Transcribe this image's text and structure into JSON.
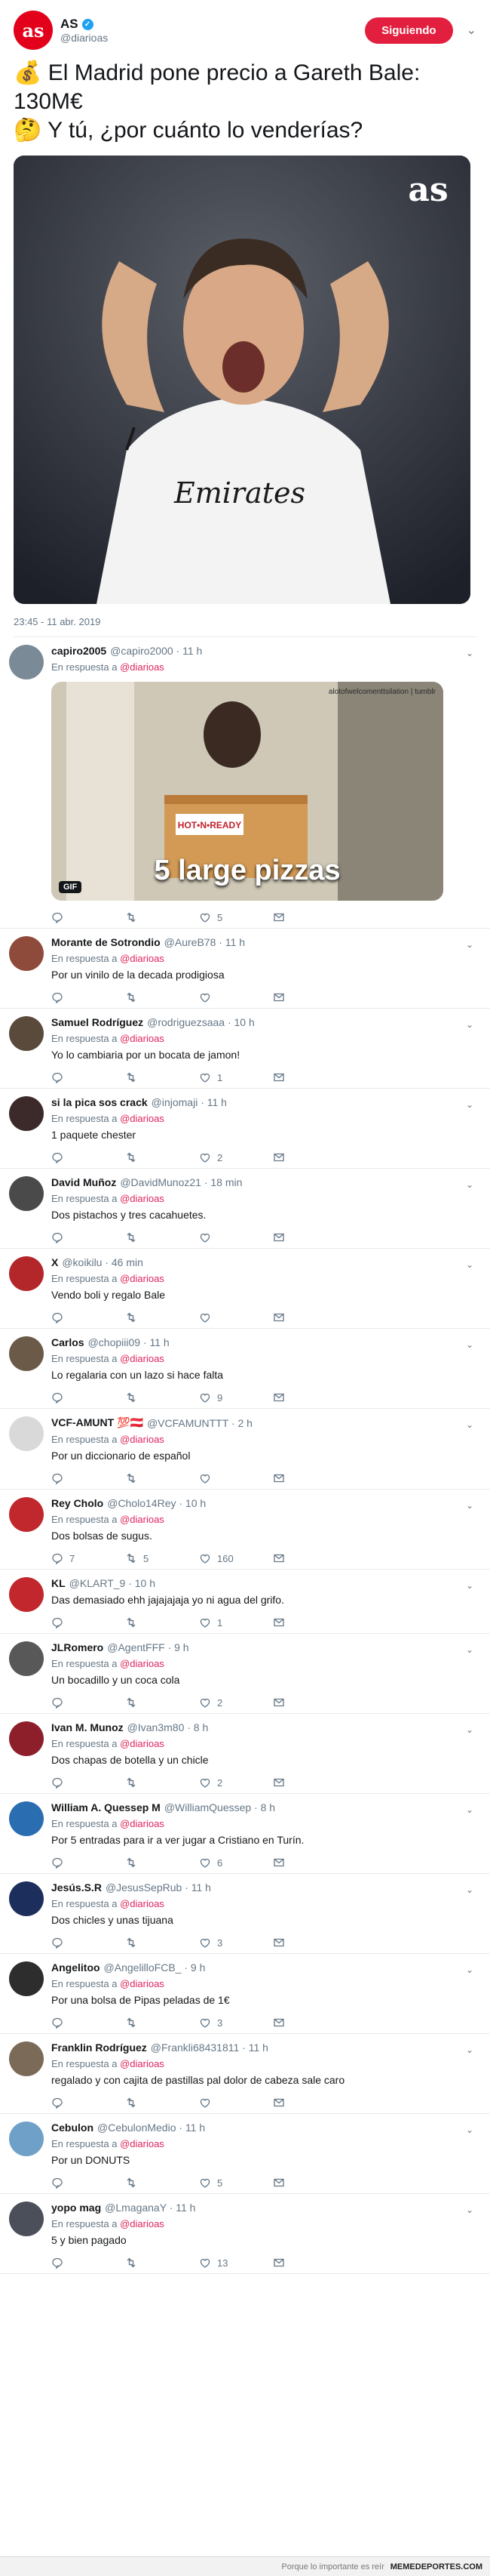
{
  "header": {
    "avatar_text": "as",
    "name": "AS",
    "handle": "@diarioas",
    "follow_label": "Siguiendo"
  },
  "tweet": {
    "line1": "💰 El Madrid pone precio a Gareth Bale: 130M€",
    "line2": "🤔 Y tú, ¿por cuánto lo venderías?",
    "image_logo": "as",
    "timestamp": "23:45 - 11 abr. 2019"
  },
  "replies": [
    {
      "name": "capiro2005",
      "handle": "@capiro2000 · 11 h",
      "resp": "En respuesta a",
      "mention": "@diarioas",
      "text": "",
      "gif": true,
      "gif_caption": "5 large pizzas",
      "gif_badge": "GIF",
      "gif_watermark": "alotofwelcomenttsilation | tumblr",
      "comments": "",
      "retweets": "",
      "likes": "5",
      "avatar_color": "#7a8a96"
    },
    {
      "name": "Morante de Sotrondio",
      "handle": "@AureB78 · 11 h",
      "resp": "En respuesta a",
      "mention": "@diarioas",
      "text": "Por un vinilo de la decada prodigiosa",
      "comments": "",
      "retweets": "",
      "likes": "",
      "avatar_color": "#8e4a3a"
    },
    {
      "name": "Samuel Rodríguez",
      "handle": "@rodriguezsaaa · 10 h",
      "resp": "En respuesta a",
      "mention": "@diarioas",
      "text": "Yo lo cambiaria por un bocata de jamon!",
      "comments": "",
      "retweets": "",
      "likes": "1",
      "avatar_color": "#5a4a3c"
    },
    {
      "name": "si la pica sos crack",
      "handle": "@injomaji · 11 h",
      "resp": "En respuesta a",
      "mention": "@diarioas",
      "text": "1 paquete chester",
      "comments": "",
      "retweets": "",
      "likes": "2",
      "avatar_color": "#3c2a2a"
    },
    {
      "name": "David Muñoz",
      "handle": "@DavidMunoz21 · 18 min",
      "resp": "En respuesta a",
      "mention": "@diarioas",
      "text": "Dos pistachos y tres cacahuetes.",
      "comments": "",
      "retweets": "",
      "likes": "",
      "avatar_color": "#4a4a4a"
    },
    {
      "name": "X",
      "handle": "@koikilu · 46 min",
      "resp": "En respuesta a",
      "mention": "@diarioas",
      "text": "Vendo boli y regalo Bale",
      "comments": "",
      "retweets": "",
      "likes": "",
      "avatar_color": "#b3262a"
    },
    {
      "name": "Carlos",
      "handle": "@chopiii09 · 11 h",
      "resp": "En respuesta a",
      "mention": "@diarioas",
      "text": "Lo regalaria con un lazo si hace falta",
      "comments": "",
      "retweets": "",
      "likes": "9",
      "avatar_color": "#6b5a48"
    },
    {
      "name": "VCF-AMUNT 💯🇦🇹",
      "handle": "@VCFAMUNTTT · 2 h",
      "resp": "En respuesta a",
      "mention": "@diarioas",
      "text": "Por un diccionario de español",
      "comments": "",
      "retweets": "",
      "likes": "",
      "avatar_color": "#d9d9d9"
    },
    {
      "name": "Rey Cholo",
      "handle": "@Cholo14Rey · 10 h",
      "resp": "En respuesta a",
      "mention": "@diarioas",
      "text": "Dos bolsas de sugus.",
      "comments": "7",
      "retweets": "5",
      "likes": "160",
      "avatar_color": "#c0282d"
    },
    {
      "name": "KL",
      "handle": "@KLART_9 · 10 h",
      "resp": "",
      "mention": "",
      "text": "Das demasiado ehh jajajajaja yo ni agua del grifo.",
      "comments": "",
      "retweets": "",
      "likes": "1",
      "avatar_color": "#c1272d"
    },
    {
      "name": "JLRomero",
      "handle": "@AgentFFF · 9 h",
      "resp": "En respuesta a",
      "mention": "@diarioas",
      "text": "Un bocadillo y un coca cola",
      "comments": "",
      "retweets": "",
      "likes": "2",
      "avatar_color": "#585858"
    },
    {
      "name": "Ivan M. Munoz",
      "handle": "@Ivan3m80 · 8 h",
      "resp": "En respuesta a",
      "mention": "@diarioas",
      "text": "Dos chapas de botella y un chicle",
      "comments": "",
      "retweets": "",
      "likes": "2",
      "avatar_color": "#8d1f2b"
    },
    {
      "name": "William A. Quessep M",
      "handle": "@WilliamQuessep · 8 h",
      "resp": "En respuesta a",
      "mention": "@diarioas",
      "text": "Por 5 entradas para ir a ver jugar a Cristiano en Turín.",
      "comments": "",
      "retweets": "",
      "likes": "6",
      "avatar_color": "#2a6db0"
    },
    {
      "name": "Jesús.S.R",
      "handle": "@JesusSepRub · 11 h",
      "resp": "En respuesta a",
      "mention": "@diarioas",
      "text": "Dos chicles y unas tijuana",
      "comments": "",
      "retweets": "",
      "likes": "3",
      "avatar_color": "#1c2f5c"
    },
    {
      "name": "Angelitoo",
      "handle": "@AngelilloFCB_ · 9 h",
      "resp": "En respuesta a",
      "mention": "@diarioas",
      "text": "Por una bolsa de Pipas peladas de 1€",
      "comments": "",
      "retweets": "",
      "likes": "3",
      "avatar_color": "#2d2d2d"
    },
    {
      "name": "Franklin Rodríguez",
      "handle": "@Frankli68431811 · 11 h",
      "resp": "En respuesta a",
      "mention": "@diarioas",
      "text": "regalado y con cajita de pastillas pal dolor de cabeza sale caro",
      "comments": "",
      "retweets": "",
      "likes": "",
      "avatar_color": "#7c6a58"
    },
    {
      "name": "Cebulon",
      "handle": "@CebulonMedio · 11 h",
      "resp": "En respuesta a",
      "mention": "@diarioas",
      "text": "Por un DONUTS",
      "comments": "",
      "retweets": "",
      "likes": "5",
      "avatar_color": "#6fa0c8"
    },
    {
      "name": "yopo mag",
      "handle": "@LmaganaY · 11 h",
      "resp": "En respuesta a",
      "mention": "@diarioas",
      "text": "5 y bien pagado",
      "comments": "",
      "retweets": "",
      "likes": "13",
      "avatar_color": "#4a4f5a"
    }
  ],
  "footer": {
    "tagline": "Porque lo importante es reír",
    "brand": "MEMEDEPORTES.COM"
  }
}
